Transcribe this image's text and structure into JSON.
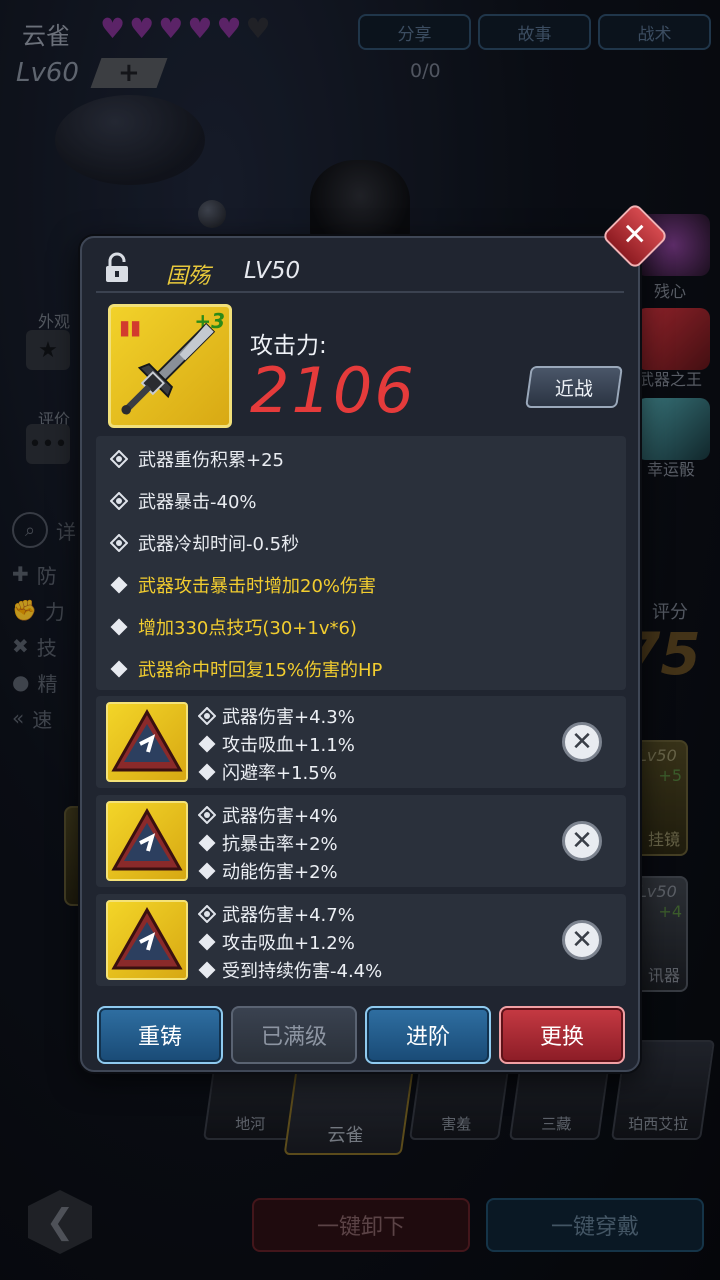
{
  "background": {
    "character_name": "云雀",
    "hearts_filled": 5,
    "hearts_total": 6,
    "top_buttons": [
      "分享",
      "故事",
      "战术"
    ],
    "level": "Lv60",
    "plus_label": "+",
    "exp": "0/0",
    "left_sidebar": {
      "appearance": "外观",
      "rating": "评价",
      "detail_icon_label": "详",
      "attributes": [
        "防",
        "力",
        "技",
        "精",
        "速"
      ]
    },
    "right_sidebar": [
      "残心",
      "武器之王",
      "幸运骰"
    ],
    "score_label": "评分",
    "score_partial": "75",
    "side_cards": [
      {
        "level": "Lv50",
        "plus": "+5",
        "label": "挂镜"
      },
      {
        "level": "Lv50",
        "plus": "+4",
        "label": "讯器"
      }
    ],
    "roster": [
      "地河",
      "云雀",
      "害羞",
      "三藏",
      "珀西艾拉"
    ],
    "unequip_all": "一键卸下",
    "equip_all": "一键穿戴"
  },
  "modal": {
    "item_name": "国殇",
    "item_level": "LV50",
    "weapon_plus": "+3",
    "attack_label": "攻击力:",
    "attack_value": "2106",
    "type_button": "近战",
    "base_stats": [
      {
        "text": "武器重伤积累+25",
        "style": "white",
        "icon": "diamond-outline-icon"
      },
      {
        "text": "武器暴击-40%",
        "style": "white",
        "icon": "diamond-outline-icon"
      },
      {
        "text": "武器冷却时间-0.5秒",
        "style": "white",
        "icon": "diamond-outline-icon"
      },
      {
        "text": "武器攻击暴击时增加20%伤害",
        "style": "gold",
        "icon": "diamond-icon"
      },
      {
        "text": "增加330点技巧(30+1v*6)",
        "style": "gold",
        "icon": "diamond-icon"
      },
      {
        "text": "武器命中时回复15%伤害的HP",
        "style": "gold",
        "icon": "diamond-icon"
      }
    ],
    "gems": [
      {
        "lines": [
          "武器伤害+4.3%",
          "攻击吸血+1.1%",
          "闪避率+1.5%"
        ]
      },
      {
        "lines": [
          "武器伤害+4%",
          "抗暴击率+2%",
          "动能伤害+2%"
        ]
      },
      {
        "lines": [
          "武器伤害+4.7%",
          "攻击吸血+1.2%",
          "受到持续伤害-4.4%"
        ]
      }
    ],
    "buttons": {
      "reforge": "重铸",
      "maxed": "已满级",
      "advance": "进阶",
      "replace": "更换"
    }
  },
  "colors": {
    "gold_text": "#f2cd2f",
    "attack_red": "#e53b3b",
    "blue_button": "#1f5a8a",
    "red_button": "#a82a33"
  }
}
